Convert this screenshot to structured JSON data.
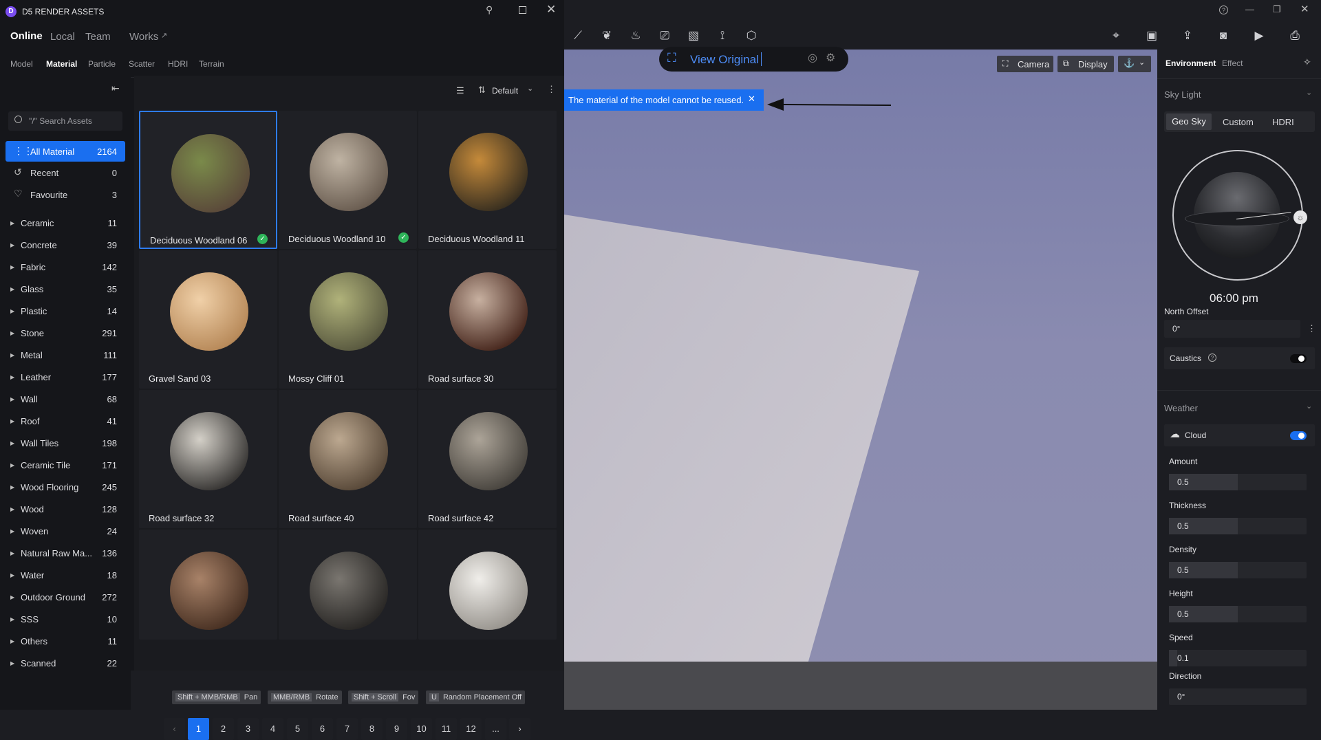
{
  "app": {
    "title": "D5 RENDER ASSETS",
    "logo_letter": "D"
  },
  "source_tabs": [
    {
      "label": "Online",
      "active": true
    },
    {
      "label": "Local",
      "active": false
    },
    {
      "label": "Team",
      "active": false
    },
    {
      "label": "Works",
      "active": false
    }
  ],
  "type_tabs": [
    {
      "label": "Model"
    },
    {
      "label": "Material"
    },
    {
      "label": "Particle"
    },
    {
      "label": "Scatter"
    },
    {
      "label": "HDRI"
    },
    {
      "label": "Terrain"
    }
  ],
  "active_type_tab": "Material",
  "search": {
    "placeholder": "\"/\" Search Assets"
  },
  "quick": [
    {
      "label": "All Material",
      "count": "2164",
      "icon": "grid-icon"
    },
    {
      "label": "Recent",
      "count": "0",
      "icon": "history-icon"
    },
    {
      "label": "Favourite",
      "count": "3",
      "icon": "heart-icon"
    }
  ],
  "categories": [
    {
      "label": "Ceramic",
      "count": "11"
    },
    {
      "label": "Concrete",
      "count": "39"
    },
    {
      "label": "Fabric",
      "count": "142"
    },
    {
      "label": "Glass",
      "count": "35"
    },
    {
      "label": "Plastic",
      "count": "14"
    },
    {
      "label": "Stone",
      "count": "291"
    },
    {
      "label": "Metal",
      "count": "111"
    },
    {
      "label": "Leather",
      "count": "177"
    },
    {
      "label": "Wall",
      "count": "68"
    },
    {
      "label": "Roof",
      "count": "41"
    },
    {
      "label": "Wall Tiles",
      "count": "198"
    },
    {
      "label": "Ceramic Tile",
      "count": "171"
    },
    {
      "label": "Wood Flooring",
      "count": "245"
    },
    {
      "label": "Wood",
      "count": "128"
    },
    {
      "label": "Woven",
      "count": "24"
    },
    {
      "label": "Natural Raw Ma...",
      "count": "136"
    },
    {
      "label": "Water",
      "count": "18"
    },
    {
      "label": "Outdoor Ground",
      "count": "272"
    },
    {
      "label": "SSS",
      "count": "10"
    },
    {
      "label": "Others",
      "count": "11"
    },
    {
      "label": "Scanned",
      "count": "22"
    }
  ],
  "sort": {
    "label": "Default"
  },
  "materials": [
    {
      "name": "Deciduous Woodland 06",
      "checked": true,
      "selected": true,
      "color1": "#7a8a4a",
      "color2": "#5b4a3a"
    },
    {
      "name": "Deciduous Woodland 10",
      "checked": true,
      "selected": false,
      "color1": "#bfb3a3",
      "color2": "#6b5e52"
    },
    {
      "name": "Deciduous Woodland 11",
      "checked": false,
      "selected": false,
      "color1": "#c58a3a",
      "color2": "#3a3020"
    },
    {
      "name": "Gravel Sand 03",
      "checked": false,
      "selected": false,
      "color1": "#f0d0a8",
      "color2": "#b88a5a"
    },
    {
      "name": "Mossy Cliff 01",
      "checked": false,
      "selected": false,
      "color1": "#b0b27a",
      "color2": "#5a5a40"
    },
    {
      "name": "Road surface 30",
      "checked": false,
      "selected": false,
      "color1": "#c7b0a0",
      "color2": "#4a2a20"
    },
    {
      "name": "Road surface 32",
      "checked": false,
      "selected": false,
      "color1": "#d4d0c8",
      "color2": "#3a3836"
    },
    {
      "name": "Road surface 40",
      "checked": false,
      "selected": false,
      "color1": "#bca890",
      "color2": "#5a4a3a"
    },
    {
      "name": "Road surface 42",
      "checked": false,
      "selected": false,
      "color1": "#aca498",
      "color2": "#4a4640"
    },
    {
      "name": "",
      "checked": false,
      "selected": false,
      "color1": "#a88268",
      "color2": "#4a3224"
    },
    {
      "name": "",
      "checked": false,
      "selected": false,
      "color1": "#7a7670",
      "color2": "#2a2826"
    },
    {
      "name": "",
      "checked": false,
      "selected": false,
      "color1": "#f0eeea",
      "color2": "#9a9690"
    }
  ],
  "pagination": {
    "pages": [
      "1",
      "2",
      "3",
      "4",
      "5",
      "6",
      "7",
      "8",
      "9",
      "10",
      "11",
      "12",
      "..."
    ],
    "current": "1"
  },
  "view_original": {
    "label": "View Original"
  },
  "toast": {
    "message": "The material of the model cannot be reused."
  },
  "viewport_buttons": [
    {
      "label": "Camera"
    },
    {
      "label": "Display"
    }
  ],
  "env_tabs": [
    {
      "label": "Environment"
    },
    {
      "label": "Effect"
    }
  ],
  "sky_light": {
    "title": "Sky Light",
    "tabs": [
      {
        "label": "Geo Sky"
      },
      {
        "label": "Custom"
      },
      {
        "label": "HDRI"
      }
    ],
    "time": "06:00 pm",
    "north_offset_label": "North Offset",
    "north_offset_value": "0°",
    "caustics_label": "Caustics"
  },
  "weather": {
    "title": "Weather",
    "cloud_label": "Cloud",
    "sliders": [
      {
        "label": "Amount",
        "value": "0.5",
        "fraction": 0.5
      },
      {
        "label": "Thickness",
        "value": "0.5",
        "fraction": 0.5
      },
      {
        "label": "Density",
        "value": "0.5",
        "fraction": 0.5
      },
      {
        "label": "Height",
        "value": "0.5",
        "fraction": 0.5
      },
      {
        "label": "Speed",
        "value": "0.1",
        "fraction": 0.06
      }
    ],
    "direction_label": "Direction",
    "direction_value": "0°"
  },
  "shortcuts": [
    {
      "key": "Shift + MMB/RMB",
      "action": "Pan"
    },
    {
      "key": "MMB/RMB",
      "action": "Rotate"
    },
    {
      "key": "Shift + Scroll",
      "action": "Fov"
    },
    {
      "key": "U",
      "action": "Random Placement Off"
    }
  ],
  "colors": {
    "accent": "#1a6ff0",
    "toast_bg": "#1a6ff0",
    "check": "#2fb55a",
    "logo": "#7a4df0"
  }
}
